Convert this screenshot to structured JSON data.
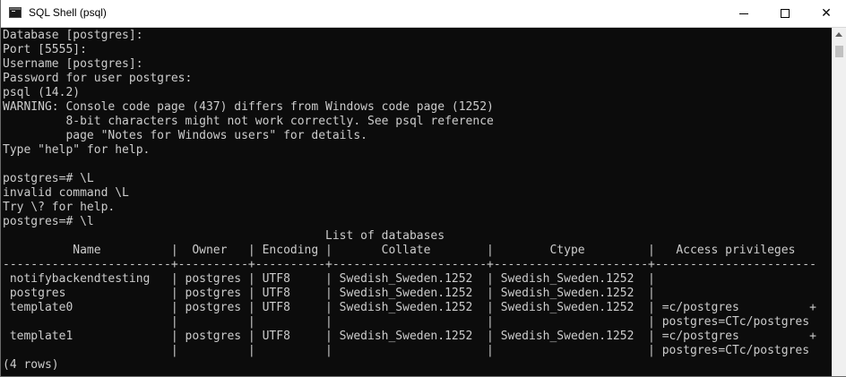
{
  "window": {
    "title": "SQL Shell (psql)",
    "close_glyph": "✕"
  },
  "icons": {
    "app": "terminal-icon",
    "minimize": "minimize-icon",
    "maximize": "maximize-icon",
    "close": "close-icon",
    "scroll_up": "chevron-up-icon"
  },
  "colors": {
    "console_bg": "#0c0c0c",
    "console_text": "#cccccc",
    "titlebar_bg": "#ffffff"
  },
  "console": {
    "lines": [
      "Database [postgres]:",
      "Port [5555]:",
      "Username [postgres]:",
      "Password for user postgres:",
      "psql (14.2)",
      "WARNING: Console code page (437) differs from Windows code page (1252)",
      "         8-bit characters might not work correctly. See psql reference",
      "         page \"Notes for Windows users\" for details.",
      "Type \"help\" for help.",
      "",
      "postgres=# \\L",
      "invalid command \\L",
      "Try \\? for help.",
      "postgres=# \\l",
      "                                              List of databases",
      "          Name          |  Owner   | Encoding |       Collate        |        Ctype         |   Access privileges",
      "------------------------+----------+----------+----------------------+----------------------+-----------------------",
      " notifybackendtesting   | postgres | UTF8     | Swedish_Sweden.1252  | Swedish_Sweden.1252  |",
      " postgres               | postgres | UTF8     | Swedish_Sweden.1252  | Swedish_Sweden.1252  |",
      " template0              | postgres | UTF8     | Swedish_Sweden.1252  | Swedish_Sweden.1252  | =c/postgres          +",
      "                        |          |          |                      |                      | postgres=CTc/postgres",
      " template1              | postgres | UTF8     | Swedish_Sweden.1252  | Swedish_Sweden.1252  | =c/postgres          +",
      "                        |          |          |                      |                      | postgres=CTc/postgres",
      "(4 rows)"
    ]
  }
}
